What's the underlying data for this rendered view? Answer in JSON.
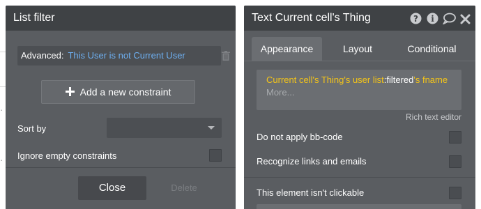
{
  "list_filter": {
    "title": "List filter",
    "advanced_label": "Advanced:",
    "advanced_value": "This User is not Current User",
    "add_constraint_label": "Add a new constraint",
    "sort_by_label": "Sort by",
    "sort_by_value": "",
    "ignore_empty_label": "Ignore empty constraints",
    "close_label": "Close",
    "delete_label": "Delete"
  },
  "properties": {
    "title": "Text Current cell's Thing",
    "header_icons": [
      "help-icon",
      "info-icon",
      "comment-icon",
      "close-icon"
    ],
    "tabs": [
      {
        "label": "Appearance",
        "active": true
      },
      {
        "label": "Layout",
        "active": false
      },
      {
        "label": "Conditional",
        "active": false
      }
    ],
    "expression": {
      "part1": "Current cell's Thing's user list",
      "part2": ":filtered",
      "part3": "'s fname"
    },
    "more_label": "More...",
    "rich_text_label": "Rich text editor",
    "options": [
      {
        "label": "Do not apply bb-code",
        "checked": false
      },
      {
        "label": "Recognize links and emails",
        "checked": false
      },
      {
        "label": "This element isn't clickable",
        "checked": false
      }
    ]
  },
  "colors": {
    "panel": "#5a5d61",
    "header": "#3f4245",
    "link_blue": "#6eb0f2",
    "expression_yellow": "#f5c518"
  }
}
